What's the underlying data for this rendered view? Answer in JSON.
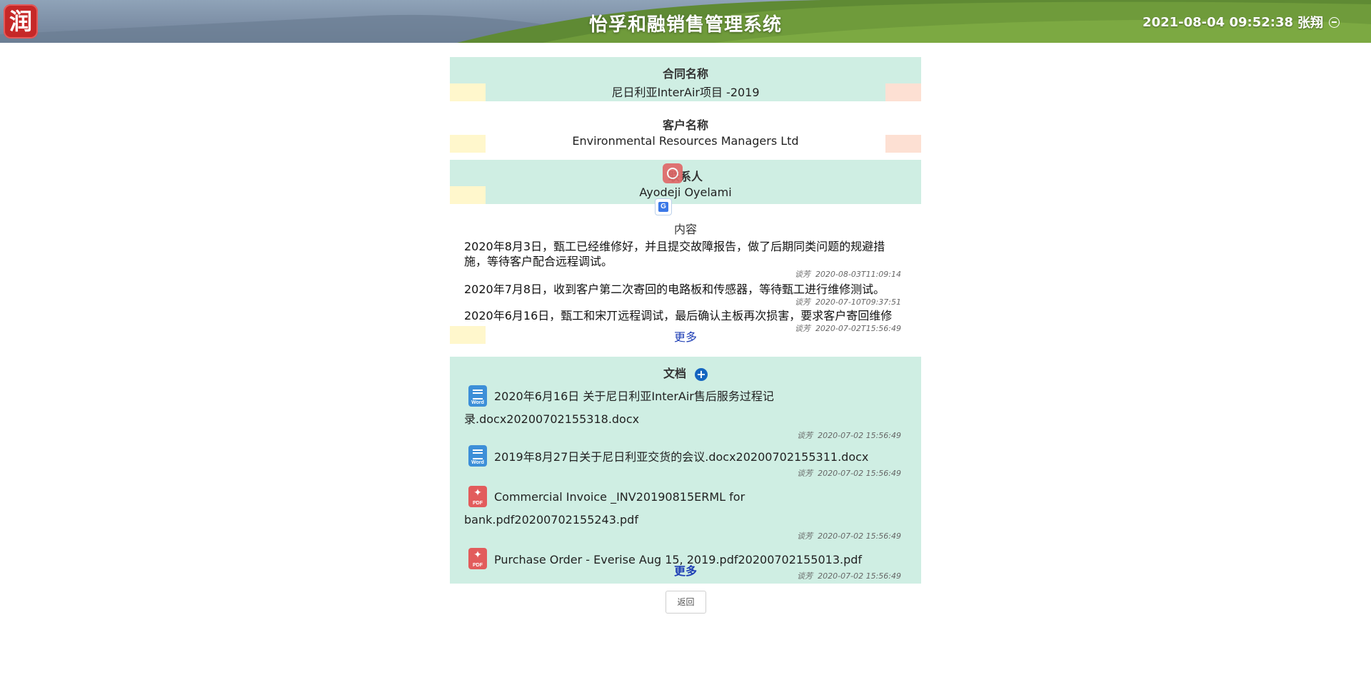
{
  "header": {
    "logo_char": "润",
    "app_title": "怡孚和融销售管理系统",
    "datetime": "2021-08-04 09:52:38",
    "username": "张翔",
    "logout_icon": "logout-circle-icon"
  },
  "contract": {
    "label": "合同名称",
    "value": "尼日利亚InterAir项目 -2019"
  },
  "customer": {
    "label": "客户名称",
    "value": "Environmental Resources Managers Ltd"
  },
  "contact": {
    "label": "联系人",
    "value": "Ayodeji Oyelami"
  },
  "content": {
    "label": "内容",
    "more": "更多",
    "notes": [
      {
        "text": "2020年8月3日，甄工已经维修好，并且提交故障报告，做了后期同类问题的规避措施，等待客户配合远程调试。",
        "author": "谈芳",
        "time": "2020-08-03T11:09:14"
      },
      {
        "text": "2020年7月8日，收到客户第二次寄回的电路板和传感器，等待甄工进行维修测试。",
        "author": "谈芳",
        "time": "2020-07-10T09:37:51"
      },
      {
        "text": "2020年6月16日，甄工和宋丌远程调试，最后确认主板再次损害，要求客户寄回维修",
        "author": "谈芳",
        "time": "2020-07-02T15:56:49"
      }
    ]
  },
  "documents": {
    "label": "文档",
    "add_icon": "add-circle-icon",
    "more": "更多",
    "items": [
      {
        "type": "word",
        "tag": "Word",
        "name_line1": "2020年6月16日 关于尼日利亚InterAir售后服务过程记",
        "name_line2": "录.docx20200702155318.docx",
        "author": "谈芳",
        "time": "2020-07-02 15:56:49"
      },
      {
        "type": "word",
        "tag": "Word",
        "name_line1": "2019年8月27日关于尼日利亚交货的会议.docx20200702155311.docx",
        "name_line2": "",
        "author": "谈芳",
        "time": "2020-07-02 15:56:49"
      },
      {
        "type": "pdf",
        "tag": "PDF",
        "name_line1": "Commercial Invoice _INV20190815ERML for bank.pdf20200702155243.pdf",
        "name_line2": "",
        "author": "谈芳",
        "time": "2020-07-02 15:56:49"
      },
      {
        "type": "pdf",
        "tag": "PDF",
        "name_line1": "Purchase Order - Everise Aug 15, 2019.pdf20200702155013.pdf",
        "name_line2": "",
        "author": "谈芳",
        "time": "2020-07-02 15:56:49"
      }
    ]
  },
  "actions": {
    "back": "返回"
  },
  "colors": {
    "mint": "#cfeee3",
    "accent_blue": "#1565c0",
    "link": "#1f3fb5",
    "logo_red": "#c62828"
  }
}
